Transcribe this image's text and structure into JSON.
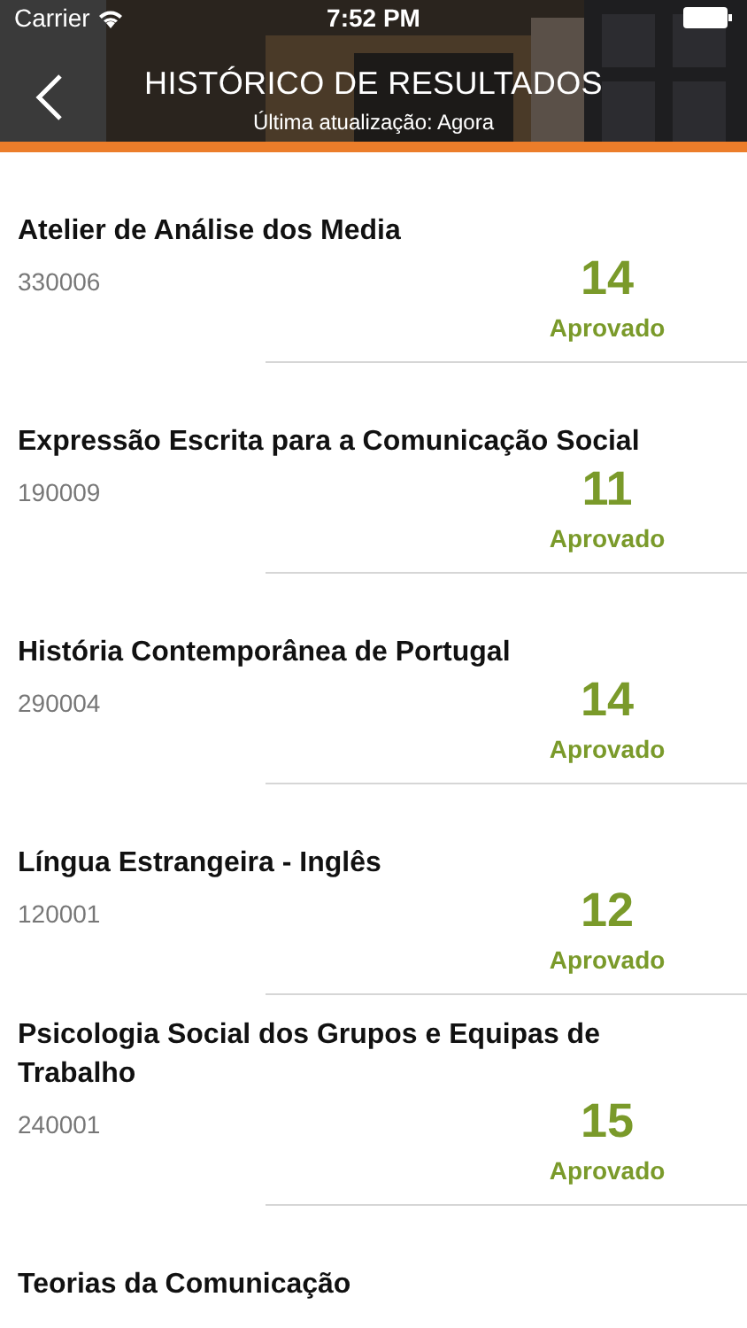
{
  "status_bar": {
    "carrier": "Carrier",
    "time": "7:52 PM"
  },
  "header": {
    "title": "HISTÓRICO DE RESULTADOS",
    "subtitle": "Última atualização: Agora"
  },
  "results": [
    {
      "title": "Atelier de Análise dos Media",
      "code": "330006",
      "grade": "14",
      "status": "Aprovado"
    },
    {
      "title": "Expressão Escrita para a Comunicação Social",
      "code": "190009",
      "grade": "11",
      "status": "Aprovado"
    },
    {
      "title": "História Contemporânea de Portugal",
      "code": "290004",
      "grade": "14",
      "status": "Aprovado"
    },
    {
      "title": "Língua Estrangeira - Inglês",
      "code": "120001",
      "grade": "12",
      "status": "Aprovado"
    },
    {
      "title": "Psicologia Social dos Grupos e Equipas de Trabalho",
      "code": "240001",
      "grade": "15",
      "status": "Aprovado"
    },
    {
      "title": "Teorias da Comunicação"
    }
  ]
}
